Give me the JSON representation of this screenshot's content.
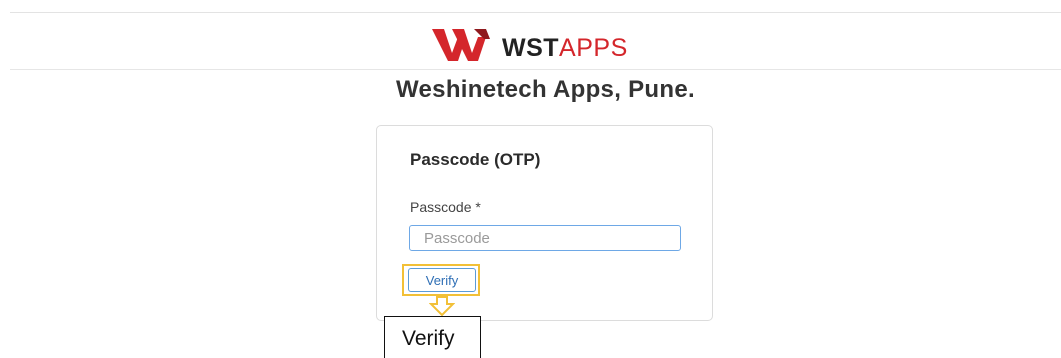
{
  "header": {
    "logo_text_bold": "WST",
    "logo_text_light": "APPS",
    "company_name": "Weshinetech Apps, Pune."
  },
  "card": {
    "title": "Passcode (OTP)",
    "field_label": "Passcode *",
    "field_placeholder": "Passcode",
    "field_value": "",
    "button_label": "Verify"
  },
  "annotation": {
    "callout_text": "Verify",
    "icon": "arrow-down-icon"
  },
  "colors": {
    "brand_red": "#d4262b",
    "highlight": "#f2c037",
    "button_text": "#2f6fb5"
  }
}
